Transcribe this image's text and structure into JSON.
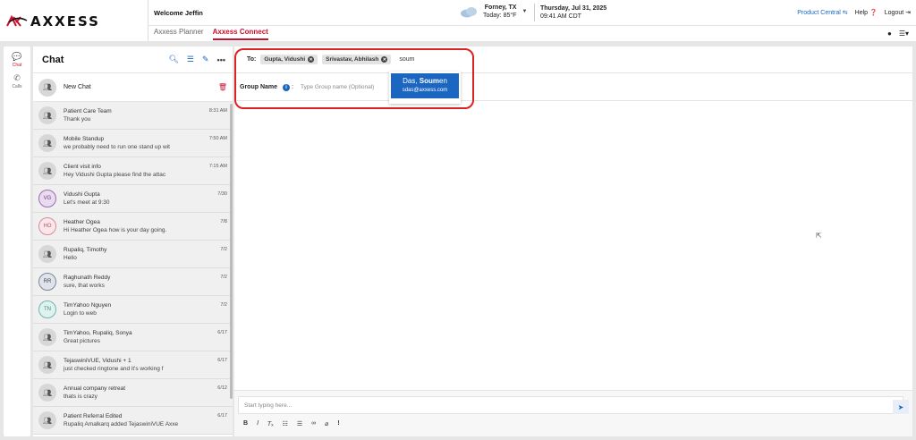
{
  "header": {
    "brand": "AXXESS",
    "welcome": "Welcome Jeffin",
    "tabs": [
      "Axxess Planner",
      "Axxess Connect"
    ],
    "weather": {
      "location": "Forney, TX",
      "today": "Today: 85°F"
    },
    "datetime": {
      "date": "Thursday, Jul 31, 2025",
      "time": "09:41 AM CDT"
    },
    "product_central": "Product Central",
    "help": "Help",
    "logout": "Logout"
  },
  "leftnav": {
    "chat": "Chat",
    "calls": "Calls"
  },
  "chatlist": {
    "title": "Chat",
    "new_chat": "New Chat",
    "items": [
      {
        "name": "Patient Care Team",
        "time": "8:31 AM",
        "msg": "Thank you",
        "avatar": "group"
      },
      {
        "name": "Mobile Standup",
        "time": "7:50 AM",
        "msg": "we probably need to run one stand up wit",
        "avatar": "group"
      },
      {
        "name": "Client visit info",
        "time": "7:15 AM",
        "msg": "Hey Vidushi Gupta  please find the attac",
        "avatar": "group"
      },
      {
        "name": "Vidushi Gupta",
        "time": "7/30",
        "msg": "Let's meet at 9:30",
        "avatar": "VG"
      },
      {
        "name": "Heather Ogea",
        "time": "7/8",
        "msg": "Hi Heather Ogea how is your day going.",
        "avatar": "HO"
      },
      {
        "name": "Rupaliq, Timothy",
        "time": "7/2",
        "msg": "Hello",
        "avatar": "group"
      },
      {
        "name": "Raghunath Reddy",
        "time": "7/2",
        "msg": "sure, that works",
        "avatar": "RR"
      },
      {
        "name": "TimYahoo Nguyen",
        "time": "7/2",
        "msg": "Login to web",
        "avatar": "TN"
      },
      {
        "name": "TimYahoo, Rupaliq, Sonya",
        "time": "6/17",
        "msg": "Great pictures",
        "avatar": "group"
      },
      {
        "name": "TejaswiniVUE, Vidushi + 1",
        "time": "6/17",
        "msg": "just checked ringtone and it's working f",
        "avatar": "group"
      },
      {
        "name": "Annual company retreat",
        "time": "6/12",
        "msg": "thats is crazy",
        "avatar": "group"
      },
      {
        "name": "Patient Referral Edited",
        "time": "6/17",
        "msg": "Rupaliq Amalkarq added TejaswiniVUE Axxe",
        "avatar": "group"
      }
    ]
  },
  "compose": {
    "to_label": "To:",
    "chips": [
      "Gupta, Vidushi",
      "Srivastav, Abhilash"
    ],
    "to_query": "soum",
    "group_label": "Group Name",
    "group_placeholder": "Type Group name (Optional)",
    "suggestion": {
      "name_pre": "Das, ",
      "name_match": "Soum",
      "name_post": "en",
      "email": "sdas@axxess.com"
    },
    "message_placeholder": "Start typing here..."
  },
  "colors": {
    "accent_red": "#c8102e",
    "link_blue": "#1a66c0",
    "highlight": "#dd2222"
  }
}
